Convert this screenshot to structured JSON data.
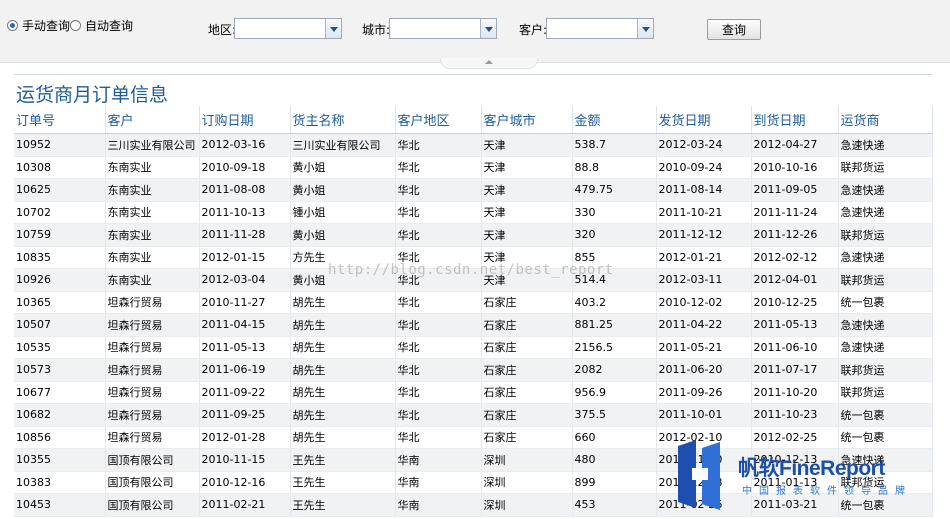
{
  "toolbar": {
    "radio_manual": "手动查询",
    "radio_auto": "自动查询",
    "region_label": "地区:",
    "city_label": "城市:",
    "customer_label": "客户:",
    "query_button": "查询"
  },
  "report": {
    "title": "运货商月订单信息",
    "columns": [
      "订单号",
      "客户",
      "订购日期",
      "货主名称",
      "客户地区",
      "客户城市",
      "金额",
      "发货日期",
      "到货日期",
      "运货商"
    ],
    "rows": [
      [
        "10952",
        "三川实业有限公司",
        "2012-03-16",
        "三川实业有限公司",
        "华北",
        "天津",
        "538.7",
        "2012-03-24",
        "2012-04-27",
        "急速快递"
      ],
      [
        "10308",
        "东南实业",
        "2010-09-18",
        "黄小姐",
        "华北",
        "天津",
        "88.8",
        "2010-09-24",
        "2010-10-16",
        "联邦货运"
      ],
      [
        "10625",
        "东南实业",
        "2011-08-08",
        "黄小姐",
        "华北",
        "天津",
        "479.75",
        "2011-08-14",
        "2011-09-05",
        "急速快递"
      ],
      [
        "10702",
        "东南实业",
        "2011-10-13",
        "锺小姐",
        "华北",
        "天津",
        "330",
        "2011-10-21",
        "2011-11-24",
        "急速快递"
      ],
      [
        "10759",
        "东南实业",
        "2011-11-28",
        "黄小姐",
        "华北",
        "天津",
        "320",
        "2011-12-12",
        "2011-12-26",
        "联邦货运"
      ],
      [
        "10835",
        "东南实业",
        "2012-01-15",
        "方先生",
        "华北",
        "天津",
        "855",
        "2012-01-21",
        "2012-02-12",
        "急速快递"
      ],
      [
        "10926",
        "东南实业",
        "2012-03-04",
        "黄小姐",
        "华北",
        "天津",
        "514.4",
        "2012-03-11",
        "2012-04-01",
        "联邦货运"
      ],
      [
        "10365",
        "坦森行贸易",
        "2010-11-27",
        "胡先生",
        "华北",
        "石家庄",
        "403.2",
        "2010-12-02",
        "2010-12-25",
        "统一包裹"
      ],
      [
        "10507",
        "坦森行贸易",
        "2011-04-15",
        "胡先生",
        "华北",
        "石家庄",
        "881.25",
        "2011-04-22",
        "2011-05-13",
        "急速快递"
      ],
      [
        "10535",
        "坦森行贸易",
        "2011-05-13",
        "胡先生",
        "华北",
        "石家庄",
        "2156.5",
        "2011-05-21",
        "2011-06-10",
        "急速快递"
      ],
      [
        "10573",
        "坦森行贸易",
        "2011-06-19",
        "胡先生",
        "华北",
        "石家庄",
        "2082",
        "2011-06-20",
        "2011-07-17",
        "联邦货运"
      ],
      [
        "10677",
        "坦森行贸易",
        "2011-09-22",
        "胡先生",
        "华北",
        "石家庄",
        "956.9",
        "2011-09-26",
        "2011-10-20",
        "联邦货运"
      ],
      [
        "10682",
        "坦森行贸易",
        "2011-09-25",
        "胡先生",
        "华北",
        "石家庄",
        "375.5",
        "2011-10-01",
        "2011-10-23",
        "统一包裹"
      ],
      [
        "10856",
        "坦森行贸易",
        "2012-01-28",
        "胡先生",
        "华北",
        "石家庄",
        "660",
        "2012-02-10",
        "2012-02-25",
        "统一包裹"
      ],
      [
        "10355",
        "国顶有限公司",
        "2010-11-15",
        "王先生",
        "华南",
        "深圳",
        "480",
        "2010-11-20",
        "2010-12-13",
        "急速快递"
      ],
      [
        "10383",
        "国顶有限公司",
        "2010-12-16",
        "王先生",
        "华南",
        "深圳",
        "899",
        "2010-12-18",
        "2011-01-13",
        "联邦货运"
      ],
      [
        "10453",
        "国顶有限公司",
        "2011-02-21",
        "王先生",
        "华南",
        "深圳",
        "453",
        "2011-02-26",
        "2011-03-21",
        "统一包裹"
      ]
    ]
  },
  "watermark": "http://blog.csdn.net/best_report",
  "logo": {
    "brand": "帆软FineReport",
    "tagline": "中国报表软件领导品牌"
  },
  "colors": {
    "accent": "#1f5c9a",
    "logo_blue": "#1d4fa8"
  }
}
